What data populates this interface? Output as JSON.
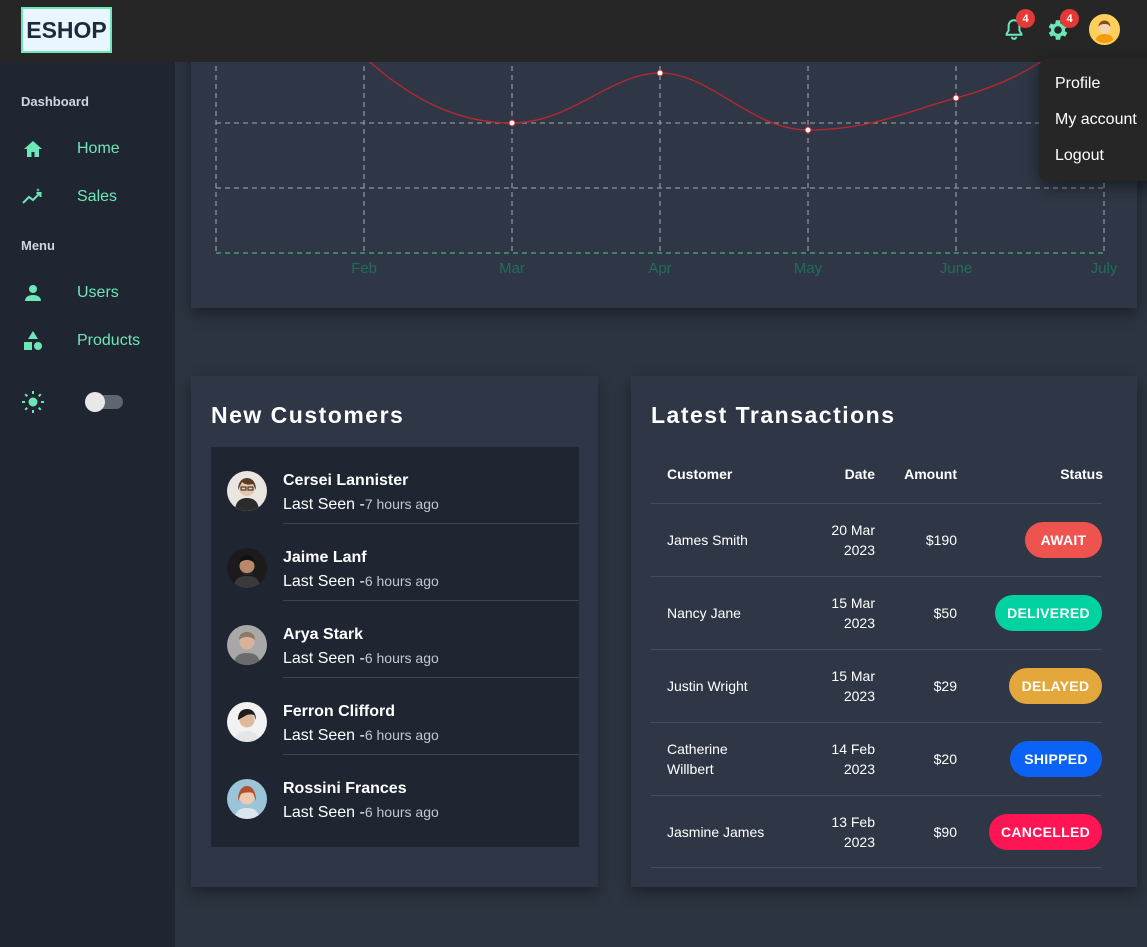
{
  "brand": {
    "logo": "ESHOP"
  },
  "header": {
    "notifications_count": "4",
    "settings_count": "4",
    "dropdown": [
      "Profile",
      "My account",
      "Logout"
    ]
  },
  "sidebar": {
    "section_dashboard": "Dashboard",
    "section_menu": "Menu",
    "items": [
      {
        "label": "Home",
        "icon": "home-icon"
      },
      {
        "label": "Sales",
        "icon": "trend-icon"
      },
      {
        "label": "Users",
        "icon": "user-icon"
      },
      {
        "label": "Products",
        "icon": "shapes-icon"
      }
    ],
    "theme_toggle": "off"
  },
  "colors": {
    "accent": "#6ee7b7",
    "line": "#c0262c",
    "await": "#ef5350",
    "delivered": "#00d3a1",
    "delayed": "#e4a73b",
    "shipped": "#0b63f6",
    "cancelled": "#ff1454"
  },
  "chart_data": {
    "type": "line",
    "categories": [
      "Feb",
      "Mar",
      "Apr",
      "May",
      "June",
      "July"
    ]
  },
  "customers": {
    "title": "New Customers",
    "seen_prefix": "Last Seen -",
    "items": [
      {
        "name": "Cersei Lannister",
        "ago": "7 hours ago"
      },
      {
        "name": "Jaime Lanf",
        "ago": "6 hours ago"
      },
      {
        "name": "Arya Stark",
        "ago": "6 hours ago"
      },
      {
        "name": "Ferron Clifford",
        "ago": "6 hours ago"
      },
      {
        "name": "Rossini Frances",
        "ago": "6 hours ago"
      }
    ]
  },
  "transactions": {
    "title": "Latest Transactions",
    "headers": [
      "Customer",
      "Date",
      "Amount",
      "Status"
    ],
    "rows": [
      {
        "customer": "James Smith",
        "date_day": "20 Mar",
        "date_year": "2023",
        "amount": "$190",
        "status": "AWAIT"
      },
      {
        "customer": "Nancy Jane",
        "date_day": "15 Mar",
        "date_year": "2023",
        "amount": "$50",
        "status": "DELIVERED"
      },
      {
        "customer": "Justin Wright",
        "date_day": "15 Mar",
        "date_year": "2023",
        "amount": "$29",
        "status": "DELAYED"
      },
      {
        "customer_line1": "Catherine",
        "customer_line2": "Willbert",
        "date_day": "14 Feb",
        "date_year": "2023",
        "amount": "$20",
        "status": "SHIPPED"
      },
      {
        "customer": "Jasmine James",
        "date_day": "13 Feb",
        "date_year": "2023",
        "amount": "$90",
        "status": "CANCELLED"
      }
    ]
  }
}
